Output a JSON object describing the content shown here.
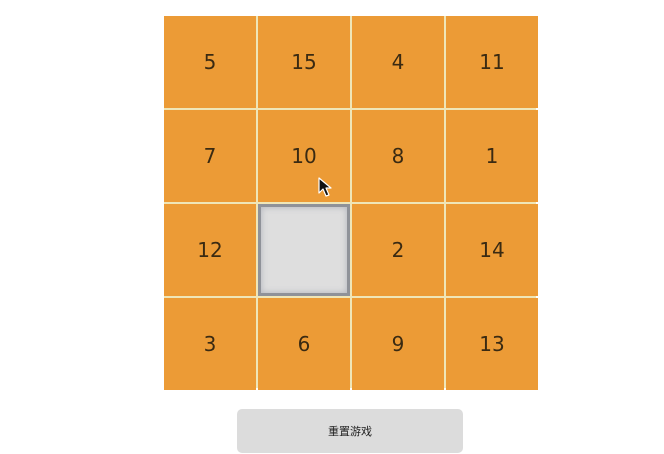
{
  "board": {
    "tiles": [
      "5",
      "15",
      "4",
      "11",
      "7",
      "10",
      "8",
      "1",
      "12",
      "",
      "2",
      "14",
      "3",
      "6",
      "9",
      "13"
    ],
    "empty_index": 9
  },
  "reset_button": {
    "label": "重置游戏"
  },
  "colors": {
    "tile": "#ec9b36",
    "grid_line": "#efe6b8",
    "empty_tile": "#dedede",
    "button": "#dcdcdc"
  },
  "icons": {
    "cursor": "mouse-pointer-icon"
  }
}
